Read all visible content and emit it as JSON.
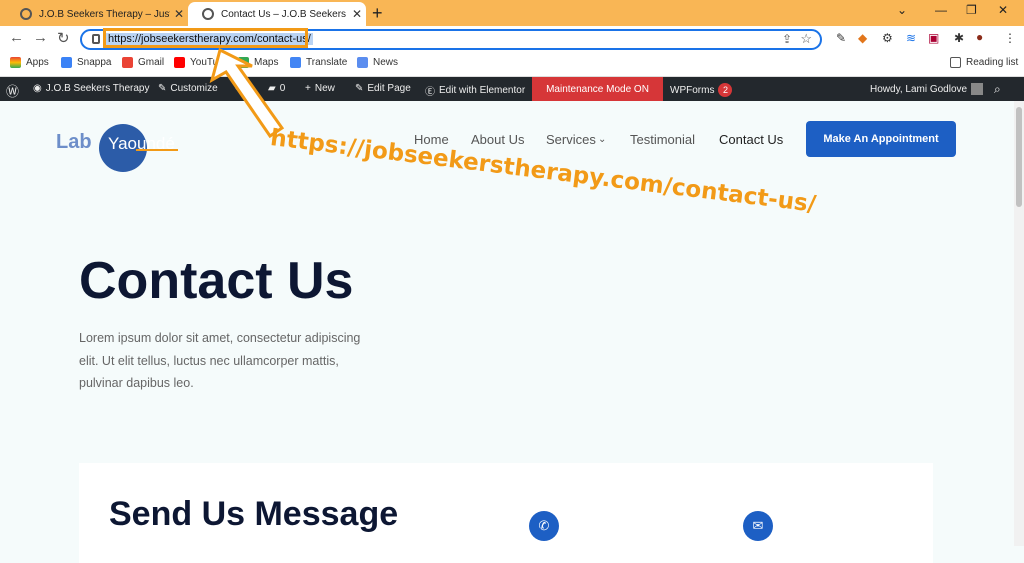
{
  "browser": {
    "tabs": [
      {
        "title": "J.O.B Seekers Therapy – Just anot"
      },
      {
        "title": "Contact Us – J.O.B Seekers Thera"
      }
    ],
    "url": "https://jobseekerstherapy.com/contact-us/",
    "bookmarks": [
      "Apps",
      "Snappa",
      "Gmail",
      "YouTube",
      "Maps",
      "Translate",
      "News"
    ],
    "reading_list": "Reading list"
  },
  "wpbar": {
    "site": "J.O.B Seekers Therapy",
    "customize": "Customize",
    "comments": "0",
    "new": "New",
    "edit_page": "Edit Page",
    "elementor": "Edit with Elementor",
    "maintenance": "Maintenance Mode ON",
    "wpforms": "WPForms",
    "wpforms_count": "2",
    "howdy": "Howdy, Lami Godlove"
  },
  "site": {
    "logo_lab": "Lab",
    "logo_yaounde": "Yaoundé",
    "nav": [
      "Home",
      "About Us",
      "Services",
      "Testimonial",
      "Contact Us"
    ],
    "cta": "Make An Appointment",
    "annotation": "https://jobseekerstherapy.com/contact-us/",
    "title": "Contact Us",
    "lead": "Lorem ipsum dolor sit amet, consectetur adipiscing elit. Ut elit tellus, luctus nec ullamcorper mattis, pulvinar dapibus leo.",
    "message_title": "Send Us Message"
  },
  "colors": {
    "accent": "#1d5fc4",
    "annotation": "#f29a17",
    "chrome": "#f9b655"
  }
}
